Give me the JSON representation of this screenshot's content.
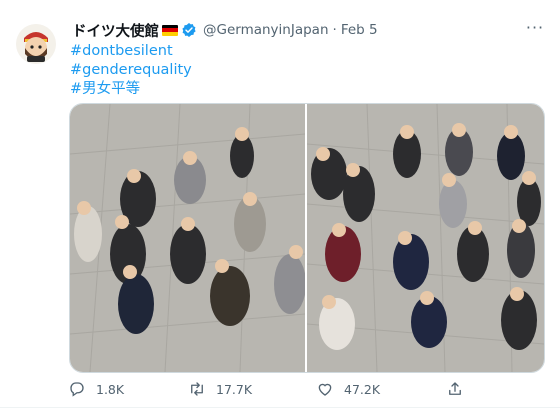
{
  "account": {
    "display_name": "ドイツ大使館",
    "handle": "@GermanyinJapan",
    "separator": "·",
    "date": "Feb 5",
    "verified": true
  },
  "hashtags": [
    "#dontbesilent",
    "#genderequality",
    "#男女平等"
  ],
  "media": {
    "photo_count": 2,
    "photos": [
      {
        "subject": "people-waving-group-photo-left"
      },
      {
        "subject": "people-waving-group-photo-right"
      }
    ]
  },
  "actions": {
    "reply": {
      "count": "1.8K",
      "icon": "reply-icon"
    },
    "retweet": {
      "count": "17.7K",
      "icon": "retweet-icon"
    },
    "like": {
      "count": "47.2K",
      "icon": "heart-icon"
    },
    "share": {
      "icon": "share-icon"
    }
  },
  "colors": {
    "link": "#1d9bf0",
    "secondary_text": "#536471",
    "verified_badge": "#1d9bf0",
    "floor": "#b8b6b0"
  }
}
